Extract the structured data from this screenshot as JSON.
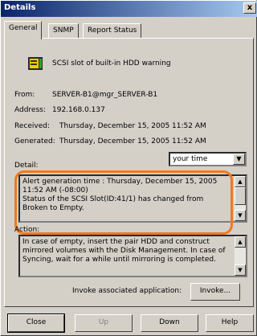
{
  "window": {
    "title": "Details",
    "close_label": "x"
  },
  "tabs": [
    {
      "label": "General"
    },
    {
      "label": "SNMP"
    },
    {
      "label": "Report Status"
    }
  ],
  "alert": {
    "title": "SCSI slot of built-in HDD warning"
  },
  "fields": {
    "from_label": "From:",
    "from_value": "SERVER-B1@mgr_SERVER-B1",
    "address_label": "Address:",
    "address_value": "192.168.0.137",
    "received_label": "Received:",
    "received_value": "Thursday, December 15, 2005 11:52 AM",
    "generated_label": "Generated:",
    "generated_value": "Thursday, December 15, 2005 11:52 AM"
  },
  "time_select": {
    "value": "your time",
    "arrow": "▼"
  },
  "detail": {
    "label": "Detail:",
    "lines": [
      "Alert generation time : Thursday, December 15, 2005",
      "11:52 AM (-08:00)",
      "Status of the SCSI Slot(ID:41/1) has changed from",
      "Broken to Empty."
    ]
  },
  "action": {
    "label": "Action:",
    "lines": [
      "In case of empty, insert the pair HDD and construct",
      "mirrored volumes with the Disk Management. In case of",
      "Syncing, wait for a while until mirroring is completed."
    ]
  },
  "invoke": {
    "label": "Invoke associated application:",
    "button": "Invoke..."
  },
  "buttons": {
    "close": "Close",
    "up": "Up",
    "down": "Down",
    "help": "Help"
  },
  "colors": {
    "highlight": "#f07820",
    "titlebar": "#0a246a"
  }
}
